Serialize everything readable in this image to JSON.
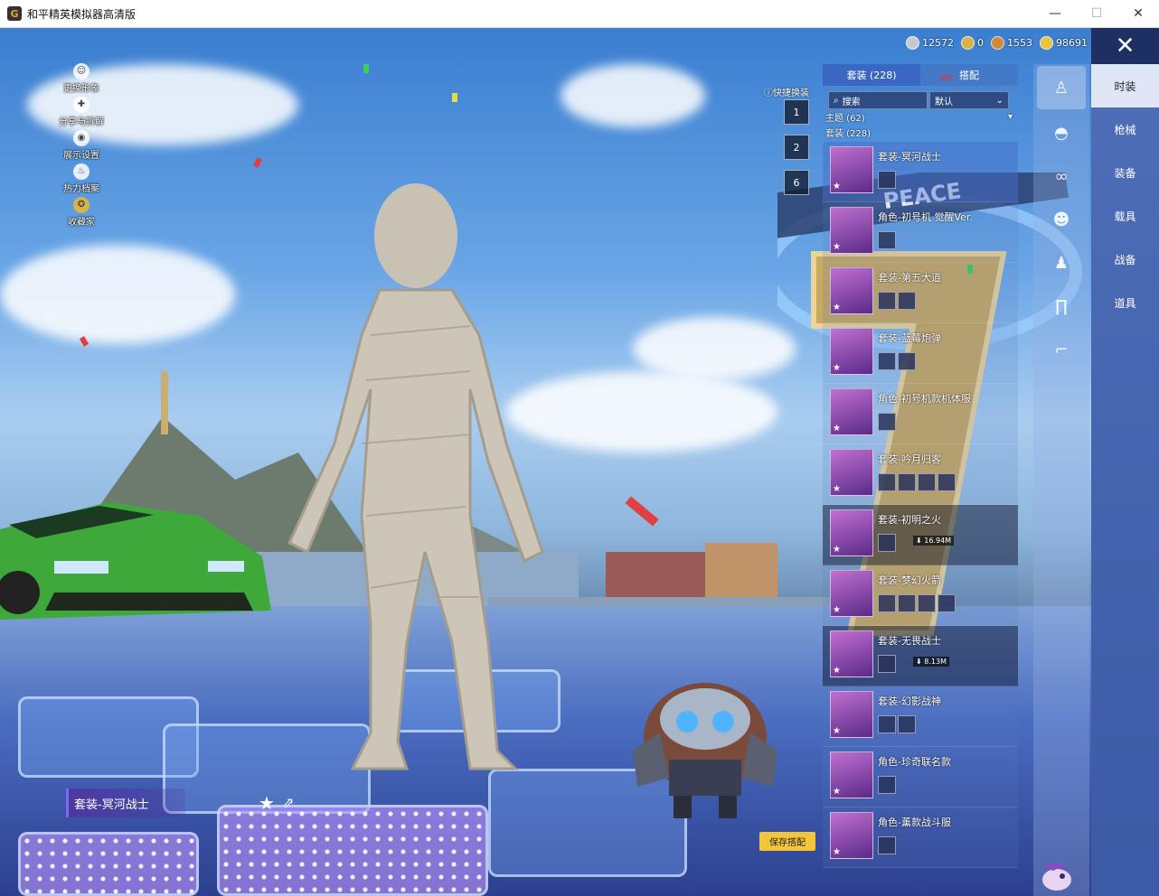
{
  "window": {
    "title": "和平精英模拟器高清版",
    "minimize": "—",
    "maximize": "☐",
    "close": "✕"
  },
  "left_menu": [
    {
      "label": "更换形象",
      "icon": "avatar-icon"
    },
    {
      "label": "分享与拆解",
      "icon": "share-icon"
    },
    {
      "label": "展示设置",
      "icon": "eye-icon"
    },
    {
      "label": "热力档案",
      "icon": "flame-icon"
    },
    {
      "label": "收藏家",
      "icon": "badge-icon"
    }
  ],
  "currencies": [
    {
      "value": "12572",
      "color": "#c8c8d0"
    },
    {
      "value": "0",
      "color": "#d8b24a"
    },
    {
      "value": "1553",
      "color": "#d08a3a"
    },
    {
      "value": "98691",
      "color": "#e8c440"
    }
  ],
  "close_panel": "✕",
  "categories": [
    {
      "label": "时装",
      "active": true
    },
    {
      "label": "枪械",
      "active": false
    },
    {
      "label": "装备",
      "active": false
    },
    {
      "label": "载具",
      "active": false
    },
    {
      "label": "战备",
      "active": false
    },
    {
      "label": "道具",
      "active": false
    }
  ],
  "sub_icons": [
    "outfit-body-icon",
    "hat-icon",
    "glasses-icon",
    "mask-icon",
    "top-icon",
    "pants-icon",
    "shoes-icon"
  ],
  "panel": {
    "tabs": [
      {
        "label": "套装 (228)",
        "active": true
      },
      {
        "label": "搭配",
        "active": false
      }
    ],
    "search_placeholder": "搜索",
    "sort_label": "默认",
    "theme_filter": "主题 (62)",
    "set_filter": "套装 (228)"
  },
  "outfits": [
    {
      "title": "套装-冥河战士",
      "parts": 1,
      "state": "selected"
    },
    {
      "title": "角色-初号机 觉醒Ver.",
      "parts": 1,
      "state": "normal"
    },
    {
      "title": "套装-第五大道",
      "parts": 2,
      "state": "normal"
    },
    {
      "title": "套装-蓝莓炮弹",
      "parts": 2,
      "state": "normal"
    },
    {
      "title": "角色-初号机款机体服",
      "parts": 1,
      "state": "normal"
    },
    {
      "title": "套装-吟月归客",
      "parts": 4,
      "state": "normal"
    },
    {
      "title": "套装-初明之火",
      "parts": 1,
      "state": "download",
      "size": "16.94M"
    },
    {
      "title": "套装-梦幻火箭",
      "parts": 4,
      "state": "normal"
    },
    {
      "title": "套装-无畏战士",
      "parts": 1,
      "state": "download",
      "size": "8.13M"
    },
    {
      "title": "套装-幻影战神",
      "parts": 2,
      "state": "normal"
    },
    {
      "title": "角色-珍奇联名款",
      "parts": 1,
      "state": "normal"
    },
    {
      "title": "角色-薰款战斗服",
      "parts": 1,
      "state": "normal"
    }
  ],
  "quick_change": {
    "label": "快捷换装",
    "slots": [
      "1",
      "2",
      "6"
    ]
  },
  "current_outfit": "套装-冥河战士",
  "save_button": "保存搭配",
  "scene_banner": "PEACE"
}
